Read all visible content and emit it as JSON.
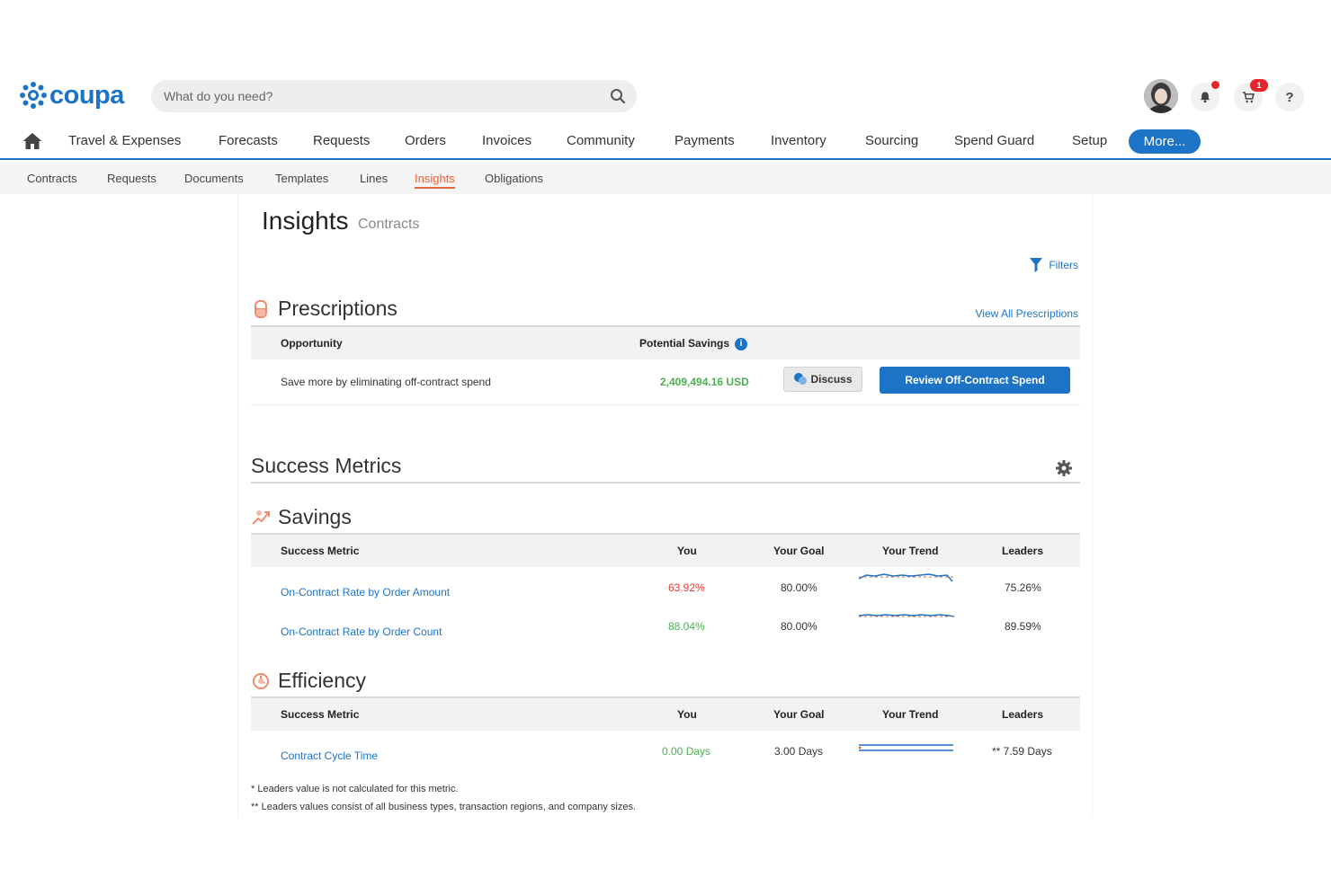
{
  "header": {
    "logo_text": "coupa",
    "search_placeholder": "What do you need?",
    "cart_badge": "1",
    "help_label": "?"
  },
  "main_nav": {
    "items": [
      "Travel & Expenses",
      "Forecasts",
      "Requests",
      "Orders",
      "Invoices",
      "Community",
      "Payments",
      "Inventory",
      "Sourcing",
      "Spend Guard",
      "Setup"
    ],
    "more_label": "More..."
  },
  "sub_nav": {
    "items": [
      "Contracts",
      "Requests",
      "Documents",
      "Templates",
      "Lines",
      "Insights",
      "Obligations"
    ],
    "active": "Insights"
  },
  "page": {
    "title": "Insights",
    "subtitle": "Contracts",
    "filters_label": "Filters"
  },
  "prescriptions": {
    "title": "Prescriptions",
    "view_all": "View All Prescriptions",
    "columns": [
      "Opportunity",
      "Potential Savings"
    ],
    "row": {
      "opportunity": "Save more by eliminating off-contract spend",
      "savings": "2,409,494.16 USD",
      "discuss_label": "Discuss",
      "review_label": "Review Off-Contract Spend"
    }
  },
  "success_metrics": {
    "title": "Success Metrics",
    "columns": [
      "Success Metric",
      "You",
      "Your Goal",
      "Your Trend",
      "Leaders"
    ],
    "savings": {
      "title": "Savings",
      "rows": [
        {
          "metric": "On-Contract Rate by Order Amount",
          "you": "63.92%",
          "goal": "80.00%",
          "leaders": "75.26%"
        },
        {
          "metric": "On-Contract Rate by Order Count",
          "you": "88.04%",
          "goal": "80.00%",
          "leaders": "89.59%"
        }
      ]
    },
    "efficiency": {
      "title": "Efficiency",
      "rows": [
        {
          "metric": "Contract Cycle Time",
          "you": "0.00 Days",
          "goal": "3.00 Days",
          "leaders": "** 7.59 Days"
        }
      ]
    }
  },
  "footnotes": {
    "one": "* Leaders value is not calculated for this metric.",
    "two": "** Leaders values consist of all business types, transaction regions, and company sizes."
  },
  "colors": {
    "brand_blue": "#1d73c6",
    "alert_red": "#e4252b",
    "good_green": "#4caf50",
    "bad_red": "#e53935",
    "active_tab": "#e8643a"
  }
}
